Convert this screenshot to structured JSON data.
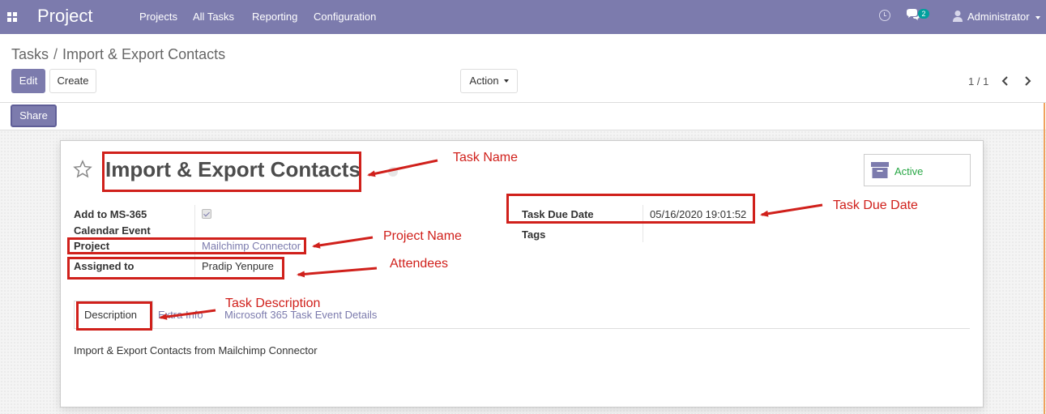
{
  "navbar": {
    "brand": "Project",
    "menu": [
      "Projects",
      "All Tasks",
      "Reporting",
      "Configuration"
    ],
    "chat_count": "2",
    "user": "Administrator"
  },
  "breadcrumb": {
    "parent": "Tasks",
    "separator": "/",
    "current": "Import & Export Contacts"
  },
  "buttons": {
    "edit": "Edit",
    "create": "Create",
    "action": "Action",
    "share": "Share"
  },
  "pager": {
    "value": "1 / 1"
  },
  "task": {
    "title": "Import & Export Contacts",
    "status": "Active",
    "fields": {
      "add_ms365_label": "Add to MS-365",
      "calendar_event_label": "Calendar Event",
      "project_label": "Project",
      "project_value": "Mailchimp Connector",
      "assigned_label": "Assigned to",
      "assigned_value": "Pradip Yenpure",
      "due_label": "Task Due Date",
      "due_value": "05/16/2020 19:01:52",
      "tags_label": "Tags"
    },
    "tabs": [
      "Description",
      "Extra Info",
      "Microsoft 365 Task Event Details"
    ],
    "description": "Import & Export Contacts from Mailchimp Connector"
  },
  "annotations": {
    "task_name": "Task Name",
    "task_due_date": "Task Due Date",
    "project_name": "Project Name",
    "attendees": "Attendees",
    "task_description": "Task Description"
  },
  "colors": {
    "navbar": "#7c7bad",
    "annotation": "#d0201b",
    "active": "#28a745",
    "link": "#7c7bad"
  }
}
